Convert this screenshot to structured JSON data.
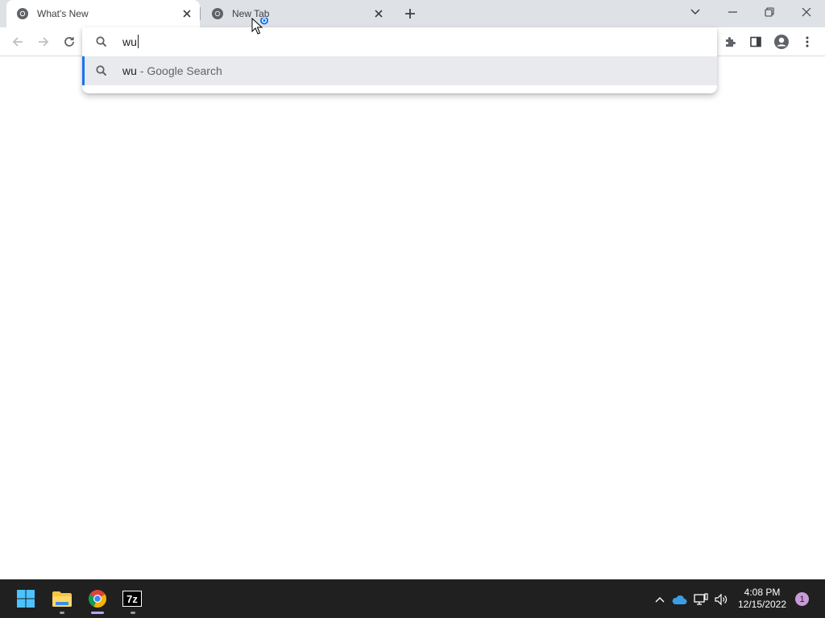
{
  "browser": {
    "tabs": [
      {
        "title": "What's New",
        "active": true
      },
      {
        "title": "New Tab",
        "active": false
      }
    ]
  },
  "omnibox": {
    "input_value": "wu",
    "suggestions": [
      {
        "query": "wu",
        "separator": " - ",
        "description": "Google Search",
        "icon": "search-icon"
      }
    ]
  },
  "taskbar": {
    "apps": [
      {
        "name": "start-button",
        "icon": "windows-icon"
      },
      {
        "name": "file-explorer",
        "icon": "folder-icon"
      },
      {
        "name": "chrome",
        "icon": "chrome-icon"
      },
      {
        "name": "7-zip",
        "icon": "7zip-icon",
        "label": "7z"
      }
    ],
    "clock": {
      "time": "4:08 PM",
      "date": "12/15/2022"
    },
    "notification_count": "1"
  },
  "colors": {
    "accent": "#1a73e8",
    "tabstrip": "#dee1e6",
    "taskbar": "#202020",
    "highlight": "#e8eaed"
  }
}
